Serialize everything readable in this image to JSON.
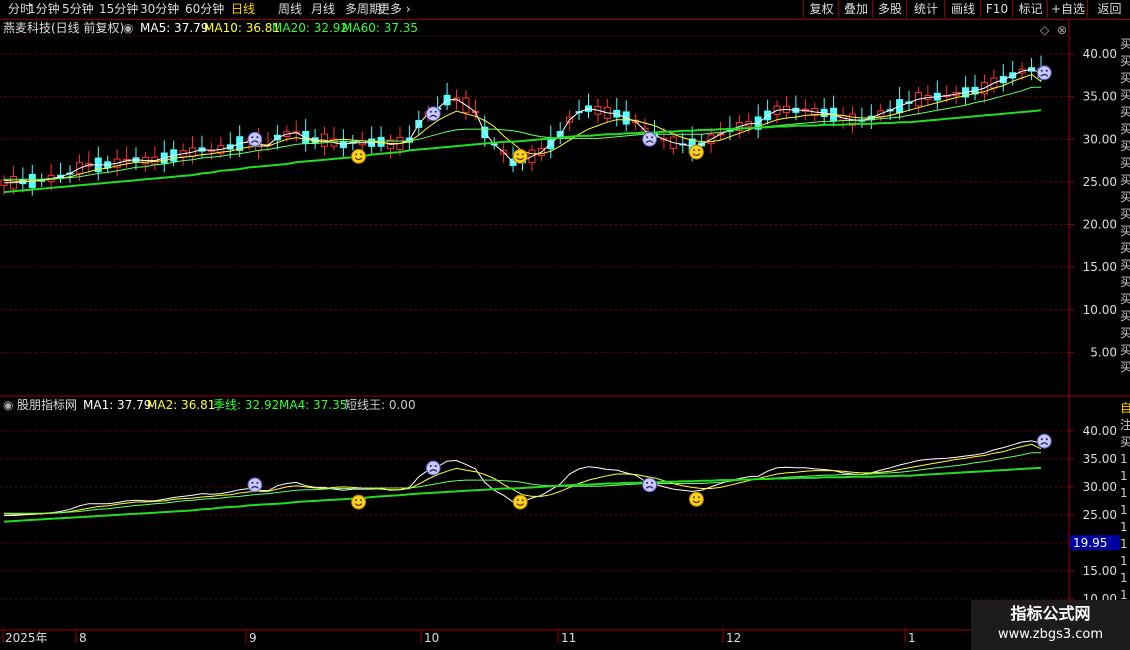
{
  "period_tabs": [
    "分时",
    "1分钟",
    "5分钟",
    "15分钟",
    "30分钟",
    "60分钟",
    "日线",
    "周线",
    "月线",
    "多周期",
    "更多"
  ],
  "active_period": "日线",
  "right_buttons": [
    "复权",
    "叠加",
    "多股",
    "统计",
    "画线",
    "F10",
    "标记",
    "+自选",
    "返回"
  ],
  "main_panel": {
    "title": "燕麦科技(日线 前复权)",
    "indicators": [
      {
        "label": "MA5: 37.79",
        "color": "#ffffff"
      },
      {
        "label": "MA10: 36.81",
        "color": "#ffff33"
      },
      {
        "label": "MA20: 32.92",
        "color": "#33ff33"
      },
      {
        "label": "MA60: 37.35",
        "color": "#33ff33"
      }
    ],
    "y_ticks": [
      "40.00",
      "35.00",
      "30.00",
      "25.00",
      "20.00",
      "15.00",
      "10.00",
      "5.00"
    ],
    "side_text": [
      "买",
      "买",
      "买",
      "买",
      "买",
      "买",
      "买",
      "买",
      "买",
      "买",
      "买",
      "买",
      "买",
      "买",
      "买",
      "买",
      "买",
      "买",
      "买",
      "买"
    ]
  },
  "sub_panel": {
    "title": "股朋指标网",
    "indicators": [
      {
        "label": "MA1: 37.79",
        "color": "#ffffff"
      },
      {
        "label": "MA2: 36.81",
        "color": "#ffff33"
      },
      {
        "label": "季线: 32.92",
        "color": "#33ff33"
      },
      {
        "label": "MA4: 37.35",
        "color": "#33ff33"
      },
      {
        "label": "短线王: 0.00",
        "color": "#cccccc"
      }
    ],
    "y_ticks": [
      "40.00",
      "35.00",
      "30.00",
      "25.00",
      "20.00",
      "15.00",
      "10.00"
    ],
    "cursor_value": "19.95",
    "side_text": [
      "自",
      "注",
      "买",
      "1",
      "1",
      "1",
      "1",
      "1",
      "1",
      "1",
      "1",
      "1",
      "1"
    ]
  },
  "x_axis": {
    "labels": [
      "2025年",
      "8",
      "9",
      "10",
      "11",
      "12",
      "1"
    ]
  },
  "watermark": {
    "line1": "指标公式网",
    "line2": "www.zbgs3.com"
  },
  "chart_data": {
    "type": "candlestick",
    "series": [
      {
        "name": "MA5",
        "values": [
          24.9,
          24.9,
          25.0,
          25.1,
          25.2,
          25.4,
          25.6,
          26.0,
          26.6,
          27.0,
          27.0,
          27.0,
          27.2,
          27.5,
          27.6,
          27.5,
          27.5,
          27.8,
          28.1,
          28.3,
          28.5,
          28.8,
          28.7,
          28.8,
          29.1,
          29.5,
          29.7,
          29.4,
          29.3,
          30.2,
          30.6,
          30.8,
          30.2,
          29.9,
          29.9,
          29.6,
          29.4,
          29.6,
          29.6,
          29.6,
          29.7,
          29.4,
          29.5,
          29.9,
          31.8,
          33.0,
          33.6,
          34.6,
          34.7,
          34.0,
          33.2,
          30.8,
          29.4,
          28.5,
          27.3,
          27.4,
          28.0,
          28.5,
          29.5,
          30.5,
          32.3,
          33.2,
          33.6,
          33.4,
          33.1,
          33.0,
          32.5,
          32.1,
          31.0,
          30.5,
          30.0,
          29.6,
          29.4,
          29.2,
          29.4,
          30.0,
          30.6,
          31.1,
          31.5,
          31.8,
          31.9,
          32.8,
          33.4,
          33.5,
          33.4,
          33.4,
          33.2,
          33.1,
          32.9,
          32.5,
          32.3,
          32.2,
          32.5,
          33.0,
          33.4,
          33.9,
          34.3,
          34.7,
          34.9,
          35.0,
          35.1,
          35.3,
          35.5,
          35.7,
          36.0,
          36.6,
          37.0,
          37.5,
          38.0,
          38.2,
          37.8
        ]
      },
      {
        "name": "MA10",
        "values": [
          25.2,
          25.1,
          25.1,
          25.1,
          25.2,
          25.3,
          25.4,
          25.6,
          25.9,
          26.2,
          26.5,
          26.6,
          26.9,
          27.1,
          27.3,
          27.3,
          27.4,
          27.5,
          27.8,
          27.9,
          28.0,
          28.2,
          28.3,
          28.5,
          28.6,
          28.9,
          29.1,
          29.2,
          29.2,
          29.6,
          30.0,
          30.2,
          30.0,
          29.8,
          29.7,
          29.9,
          30.0,
          29.9,
          29.8,
          29.7,
          29.6,
          29.5,
          29.5,
          29.7,
          30.5,
          31.4,
          32.2,
          32.8,
          33.3,
          33.0,
          32.7,
          32.2,
          31.5,
          30.4,
          29.5,
          28.6,
          28.3,
          28.3,
          28.6,
          29.2,
          29.9,
          30.6,
          31.2,
          31.6,
          32.0,
          32.3,
          32.3,
          32.2,
          31.9,
          31.6,
          31.1,
          30.6,
          30.2,
          29.9,
          29.7,
          29.7,
          29.9,
          30.3,
          30.7,
          31.1,
          31.5,
          31.9,
          32.3,
          32.5,
          32.6,
          32.8,
          32.9,
          32.9,
          32.9,
          32.8,
          32.6,
          32.5,
          32.5,
          32.6,
          32.8,
          33.1,
          33.4,
          33.7,
          34.0,
          34.3,
          34.6,
          34.9,
          35.1,
          35.4,
          35.6,
          36.0,
          36.3,
          36.8,
          37.2,
          37.6,
          36.8
        ]
      },
      {
        "name": "MA20",
        "values": [
          25.3,
          25.3,
          25.3,
          25.3,
          25.3,
          25.4,
          25.4,
          25.5,
          25.6,
          25.8,
          26.0,
          26.1,
          26.3,
          26.5,
          26.7,
          26.8,
          27.0,
          27.1,
          27.3,
          27.5,
          27.6,
          27.8,
          27.9,
          28.0,
          28.2,
          28.3,
          28.5,
          28.7,
          28.8,
          29.0,
          29.2,
          29.4,
          29.5,
          29.5,
          29.6,
          29.7,
          29.7,
          29.7,
          29.8,
          29.8,
          29.8,
          29.8,
          29.8,
          29.8,
          30.0,
          30.3,
          30.6,
          30.9,
          31.1,
          31.2,
          31.2,
          31.2,
          31.2,
          31.1,
          31.0,
          30.8,
          30.5,
          30.3,
          30.2,
          30.1,
          30.1,
          30.1,
          30.1,
          30.1,
          30.2,
          30.3,
          30.4,
          30.5,
          30.6,
          30.6,
          30.6,
          30.6,
          30.6,
          30.6,
          30.6,
          30.7,
          30.8,
          31.0,
          31.2,
          31.3,
          31.4,
          31.5,
          31.6,
          31.7,
          31.8,
          31.9,
          32.0,
          32.1,
          32.1,
          32.2,
          32.2,
          32.2,
          32.3,
          32.4,
          32.5,
          32.6,
          32.8,
          33.0,
          33.2,
          33.4,
          33.6,
          33.8,
          34.0,
          34.3,
          34.5,
          34.8,
          35.1,
          35.4,
          35.7,
          36.1,
          32.9
        ]
      },
      {
        "name": "MA60",
        "values": [
          23.8,
          23.9,
          24.0,
          24.1,
          24.2,
          24.3,
          24.4,
          24.5,
          24.6,
          24.7,
          24.8,
          24.9,
          25.0,
          25.1,
          25.2,
          25.3,
          25.4,
          25.5,
          25.6,
          25.7,
          25.8,
          26.0,
          26.1,
          26.3,
          26.4,
          26.5,
          26.7,
          26.8,
          26.9,
          27.0,
          27.1,
          27.3,
          27.4,
          27.5,
          27.6,
          27.7,
          27.8,
          27.9,
          28.0,
          28.2,
          28.3,
          28.4,
          28.5,
          28.7,
          28.8,
          28.9,
          29.0,
          29.1,
          29.2,
          29.3,
          29.4,
          29.5,
          29.6,
          29.7,
          29.7,
          29.8,
          29.9,
          30.0,
          30.1,
          30.2,
          30.3,
          30.4,
          30.4,
          30.5,
          30.6,
          30.6,
          30.7,
          30.7,
          30.8,
          30.8,
          30.9,
          30.9,
          31.0,
          31.0,
          31.1,
          31.1,
          31.2,
          31.2,
          31.3,
          31.3,
          31.4,
          31.4,
          31.5,
          31.5,
          31.6,
          31.6,
          31.6,
          31.7,
          31.7,
          31.7,
          31.8,
          31.8,
          31.8,
          31.9,
          31.9,
          32.0,
          32.0,
          32.1,
          32.2,
          32.3,
          32.4,
          32.5,
          32.6,
          32.7,
          32.8,
          32.9,
          33.0,
          33.1,
          33.2,
          33.3,
          33.4
        ]
      }
    ],
    "signals": [
      {
        "type": "buy",
        "x": 0.318,
        "y": 28.0
      },
      {
        "type": "sell",
        "x": 0.225,
        "y": 30.0
      },
      {
        "type": "sell",
        "x": 0.385,
        "y": 33.0
      },
      {
        "type": "buy",
        "x": 0.463,
        "y": 28.0
      },
      {
        "type": "sell",
        "x": 0.579,
        "y": 30.0
      },
      {
        "type": "buy",
        "x": 0.621,
        "y": 28.5
      },
      {
        "type": "sell",
        "x": 0.933,
        "y": 37.8
      }
    ],
    "ylim": [
      0,
      42
    ]
  }
}
